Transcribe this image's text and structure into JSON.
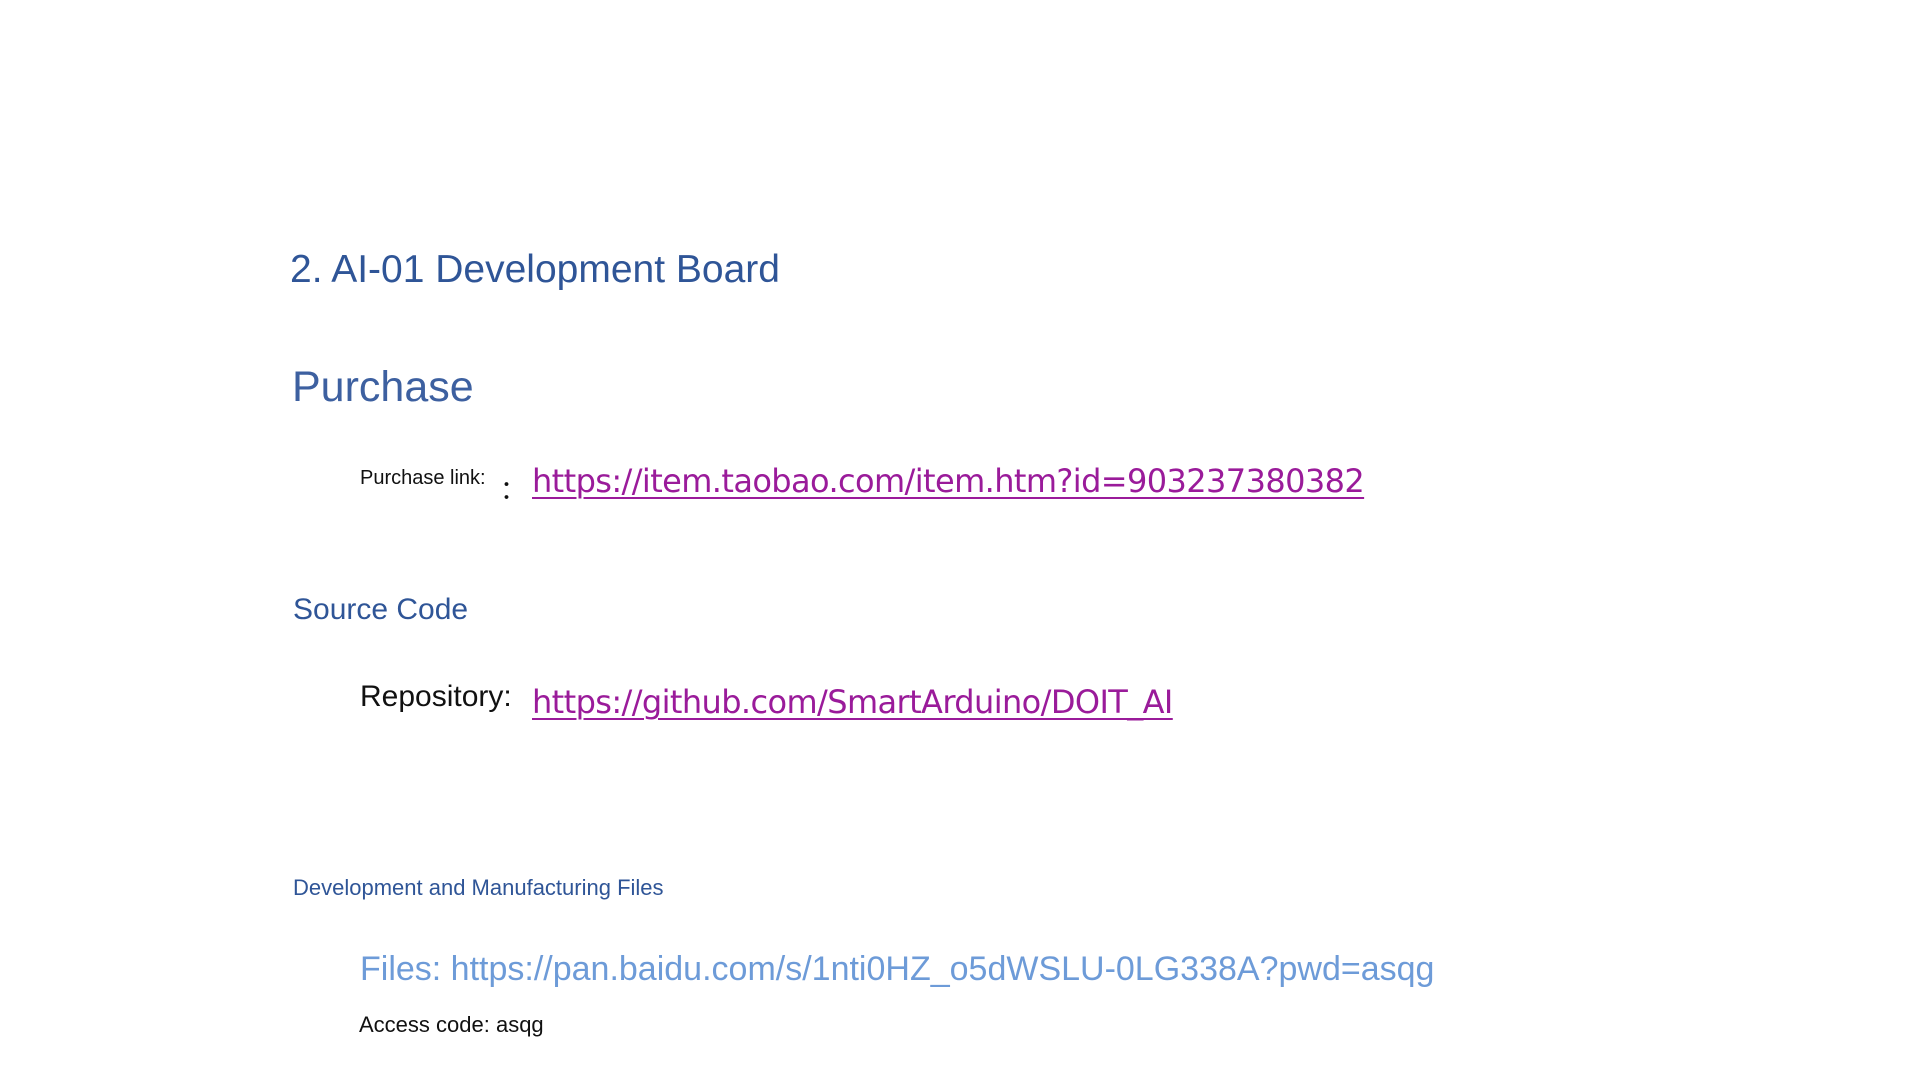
{
  "document": {
    "section_heading": "2. AI-01 Development Board",
    "purchase": {
      "heading": "Purchase",
      "label": "Purchase link:",
      "colon": "：",
      "url": "https://item.taobao.com/item.htm?id=903237380382"
    },
    "source_code": {
      "heading": "Source Code",
      "label": "Repository:",
      "url": "https://github.com/SmartArduino/DOIT_AI"
    },
    "dev_files": {
      "heading": "Development and Manufacturing Files",
      "files_text": "Files: https://pan.baidu.com/s/1nti0HZ_o5dWSLU-0LG338A?pwd=asqg",
      "access_code": "Access code: asqg"
    }
  },
  "colors": {
    "heading": "#2f5597",
    "link": "#9a1b9a",
    "files_link": "#6d9bd8",
    "body_text": "#111111"
  }
}
